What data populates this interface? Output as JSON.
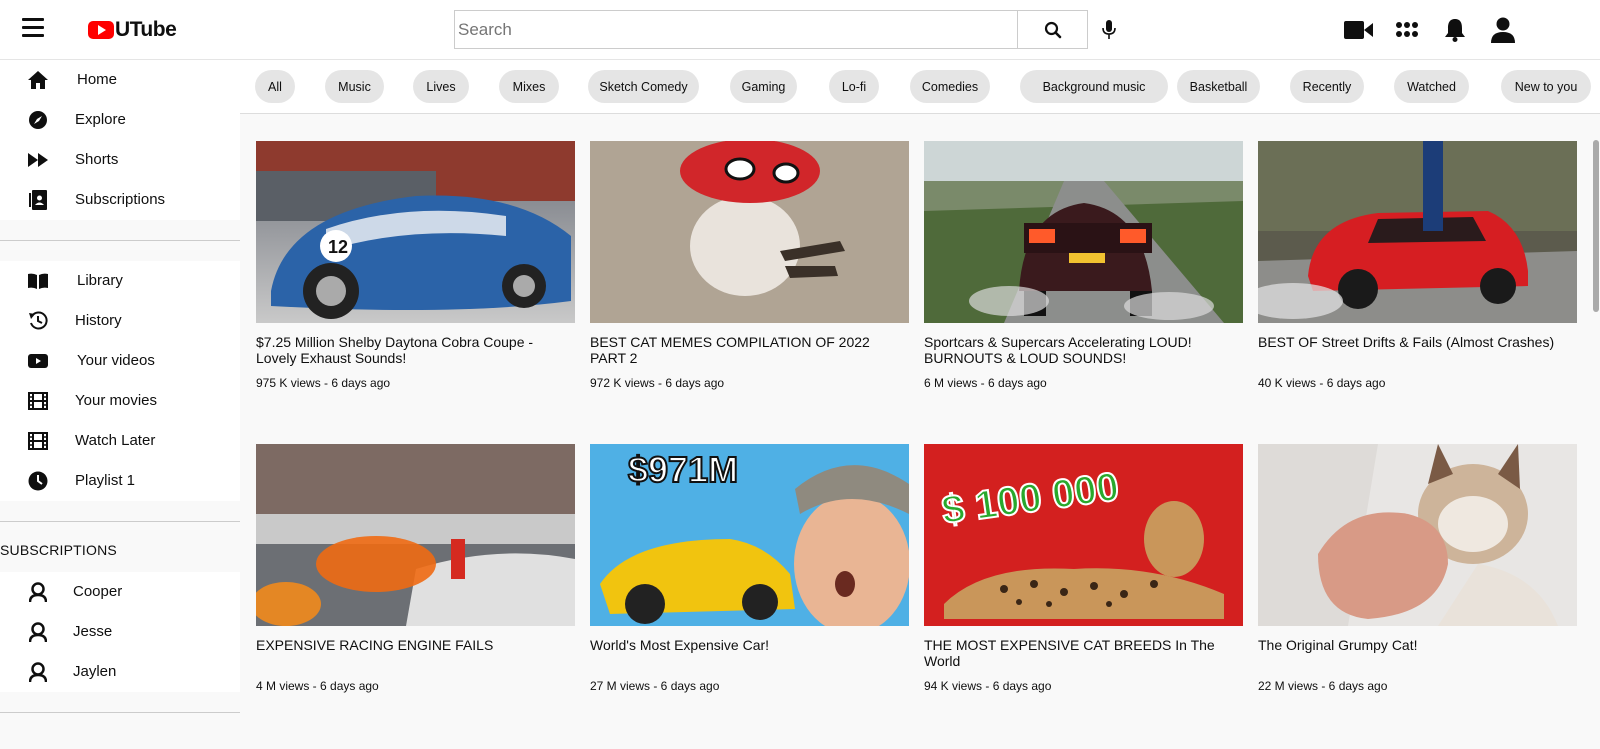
{
  "app": {
    "logo_text": "UTube"
  },
  "search": {
    "placeholder": "Search"
  },
  "sidebar": {
    "main": [
      {
        "label": "Home",
        "icon": "home-icon"
      },
      {
        "label": "Explore",
        "icon": "compass-icon"
      },
      {
        "label": "Shorts",
        "icon": "shorts-icon"
      },
      {
        "label": "Subscriptions",
        "icon": "subscriptions-icon"
      }
    ],
    "library": [
      {
        "label": "Library",
        "icon": "library-icon"
      },
      {
        "label": "History",
        "icon": "history-icon"
      },
      {
        "label": "Your videos",
        "icon": "your-videos-icon"
      },
      {
        "label": "Your movies",
        "icon": "film-icon"
      },
      {
        "label": "Watch Later",
        "icon": "film-icon"
      },
      {
        "label": "Playlist 1",
        "icon": "clock-icon"
      }
    ],
    "subscriptions_header": "SUBSCRIPTIONS",
    "subscriptions": [
      {
        "label": "Cooper",
        "icon": "channel-icon"
      },
      {
        "label": "Jesse",
        "icon": "channel-icon"
      },
      {
        "label": "Jaylen",
        "icon": "channel-icon"
      }
    ]
  },
  "chips": [
    "All",
    "Music",
    "Lives",
    "Mixes",
    "Sketch Comedy",
    "Gaming",
    "Lo-fi",
    "Comedies",
    "Background music",
    "Basketball",
    "Recently",
    "Watched",
    "New to you"
  ],
  "videos": [
    {
      "title": "$7.25 Million Shelby Daytona Cobra Coupe - Lovely Exhaust Sounds!",
      "meta": "975 K views - 6 days ago",
      "thumb_text": ""
    },
    {
      "title": "BEST CAT MEMES COMPILATION OF 2022 PART 2",
      "meta": "972 K views - 6 days ago",
      "thumb_text": ""
    },
    {
      "title": "Sportcars & Supercars Accelerating LOUD! BURNOUTS & LOUD SOUNDS!",
      "meta": "6 M views - 6 days ago",
      "thumb_text": ""
    },
    {
      "title": "BEST OF Street Drifts & Fails (Almost Crashes)",
      "meta": "40 K views - 6 days ago",
      "thumb_text": ""
    },
    {
      "title": "EXPENSIVE RACING ENGINE FAILS",
      "meta": "4 M views - 6 days ago",
      "thumb_text": ""
    },
    {
      "title": "World's Most Expensive Car!",
      "meta": "27 M views - 6 days ago",
      "thumb_text": "$971M"
    },
    {
      "title": "THE MOST EXPENSIVE CAT BREEDS In The World",
      "meta": "94 K views - 6 days ago",
      "thumb_text": "$ 100 000"
    },
    {
      "title": "The Original Grumpy Cat!",
      "meta": "22 M views - 6 days ago",
      "thumb_text": ""
    }
  ],
  "colors": {
    "brand": "#ff0000",
    "chip_bg": "#e5e5e5",
    "background": "#f9f9f9"
  }
}
